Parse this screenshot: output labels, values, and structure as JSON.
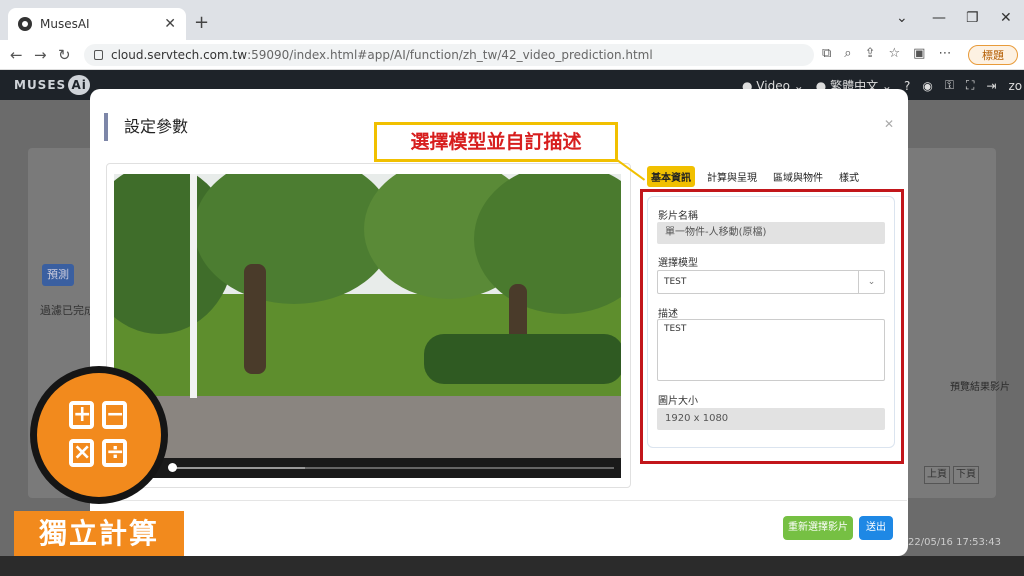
{
  "browser": {
    "tab_title": "MusesAI",
    "url_host": "cloud.servtech.com.tw",
    "url_path": ":59090/index.html#app/AI/function/zh_tw/42_video_prediction.html",
    "profile_label": "標題"
  },
  "app": {
    "logo_text": "MUSES",
    "logo_suffix": "Ai",
    "header_video": "Video",
    "header_lang": "繁體中文",
    "header_user": "zo"
  },
  "background": {
    "btn_label": "預測",
    "status_text": "過濾已完成",
    "col_header": "預覽結果影片",
    "pager_prev": "上頁",
    "pager_next": "下頁",
    "timestamp": "22/05/16 17:53:43"
  },
  "modal": {
    "title": "設定參數",
    "callout": "選擇模型並自訂描述",
    "tabs": [
      "基本資訊",
      "計算與呈現",
      "區域與物件",
      "樣式"
    ],
    "form": {
      "video_name_label": "影片名稱",
      "video_name_value": "單一物件-人移動(原檔)",
      "model_label": "選擇模型",
      "model_value": "TEST",
      "desc_label": "描述",
      "desc_value": "TEST",
      "size_label": "圖片大小",
      "size_value": "1920 x 1080"
    },
    "reselect_button": "重新選擇影片",
    "submit_button": "送出"
  },
  "overlay": {
    "label": "獨立計算"
  },
  "video_progress_fraction": 0.3
}
